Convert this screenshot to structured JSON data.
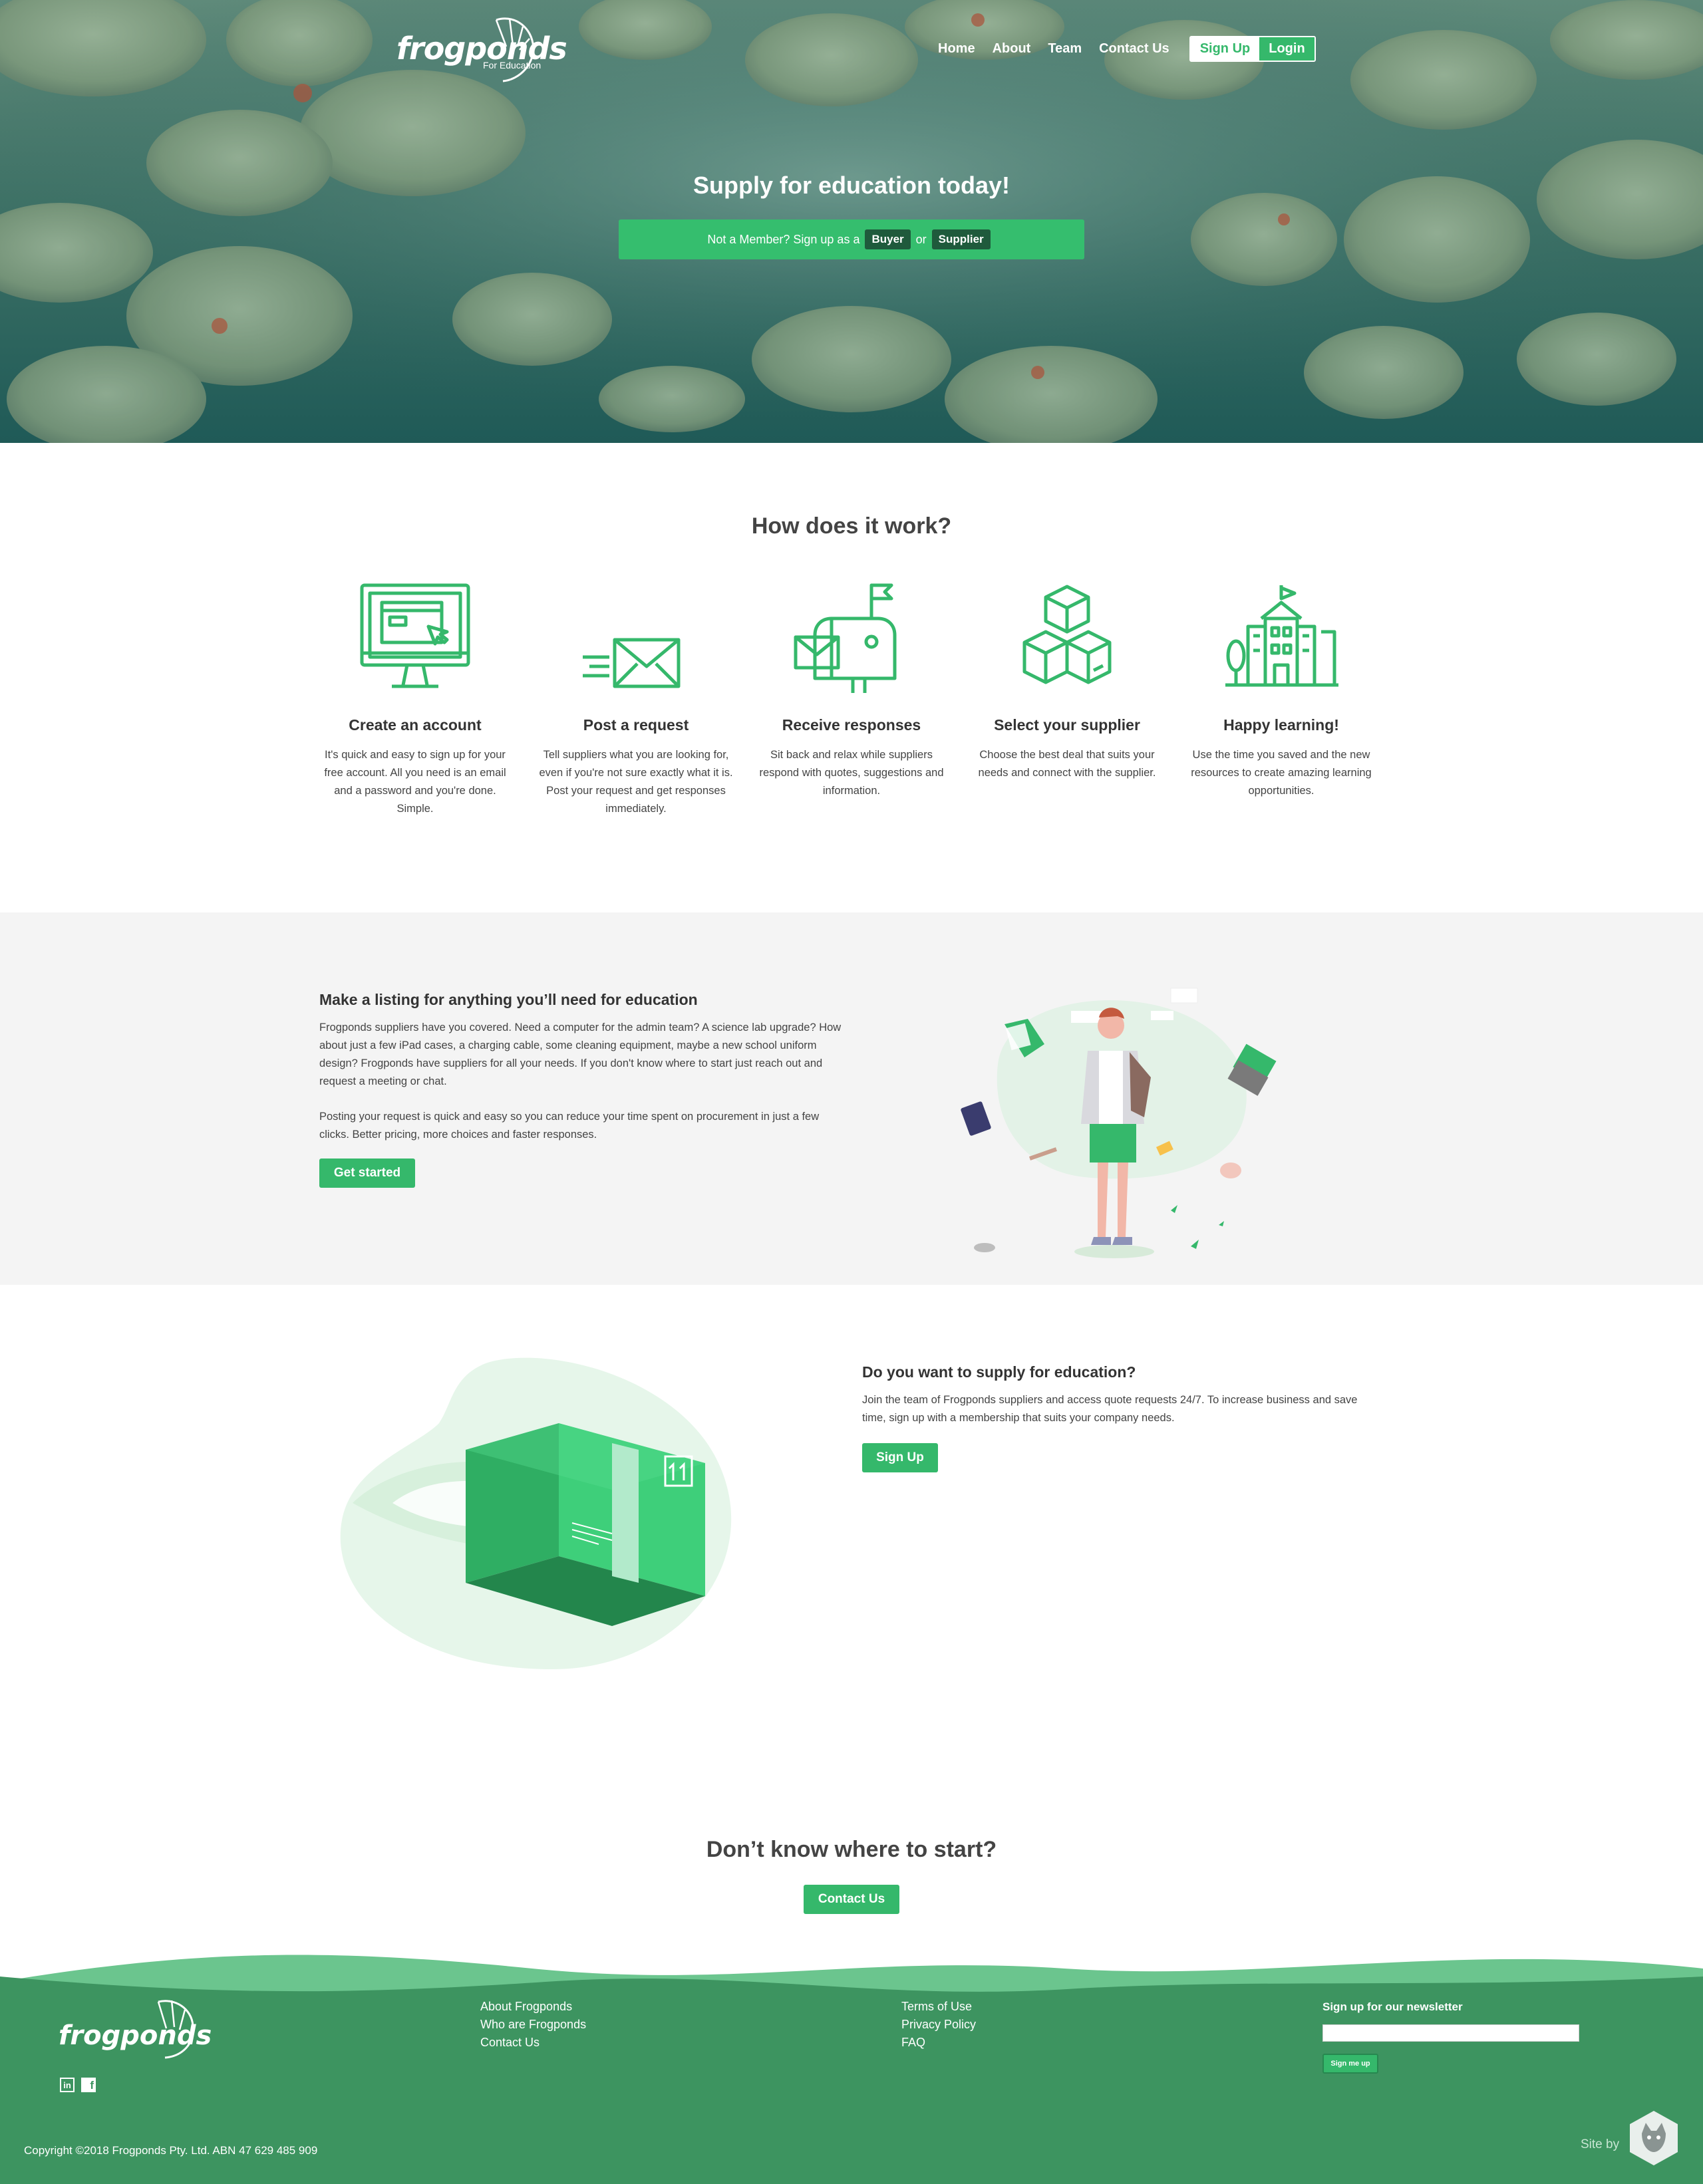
{
  "brand": {
    "name": "frogponds",
    "tagline": "For Education"
  },
  "nav": {
    "home": "Home",
    "about": "About",
    "team": "Team",
    "contact": "Contact Us",
    "signup": "Sign Up",
    "login": "Login"
  },
  "hero": {
    "title": "Supply for education today!",
    "prompt": "Not a Member? Sign up as a",
    "buyer": "Buyer",
    "or": "or",
    "supplier": "Supplier"
  },
  "how": {
    "title": "How does it work?",
    "steps": [
      {
        "title": "Create an account",
        "text": "It's quick and easy to sign up for your free account. All you need is an email and a password and you're done. Simple.",
        "icon": "computer-icon"
      },
      {
        "title": "Post a request",
        "text": "Tell suppliers what you are looking for, even if you're not sure exactly what it is. Post your request and get responses immediately.",
        "icon": "envelope-icon"
      },
      {
        "title": "Receive responses",
        "text": "Sit back and relax while suppliers respond with quotes, suggestions and information.",
        "icon": "mailbox-icon"
      },
      {
        "title": "Select your supplier",
        "text": "Choose the best deal that suits your needs and connect with the supplier.",
        "icon": "boxes-icon"
      },
      {
        "title": "Happy learning!",
        "text": "Use the time you saved and the new resources to create amazing learning opportunities.",
        "icon": "school-icon"
      }
    ]
  },
  "listing": {
    "title": "Make a listing for anything you’ll need for education",
    "p1": "Frogponds suppliers have you covered. Need a computer for the admin team? A science lab upgrade? How about just a few iPad cases, a charging cable, some cleaning equipment, maybe a new school uniform design? Frogponds have suppliers for all your needs. If you don't know where to start just reach out and request a meeting or chat.",
    "p2": "Posting your request is quick and easy so you can reduce your time spent on procurement in just a few clicks. Better pricing, more choices and faster responses.",
    "button": "Get started"
  },
  "supply": {
    "title": "Do you want to supply for education?",
    "text": "Join the team of Frogponds suppliers and access quote requests 24/7. To increase business and save time, sign up with a membership that suits your company needs.",
    "button": "Sign Up"
  },
  "start": {
    "title": "Don’t know where to start?",
    "button": "Contact Us"
  },
  "footer": {
    "col1": [
      "About Frogponds",
      "Who are Frogponds",
      "Contact Us"
    ],
    "col2": [
      "Terms of Use",
      "Privacy Policy",
      "FAQ"
    ],
    "newsletter_title": "Sign up for our newsletter",
    "newsletter_button": "Sign me up",
    "copyright": "Copyright ©2018 Frogponds Pty. Ltd. ABN 47 629 485 909",
    "siteby": "Site by"
  },
  "colors": {
    "accent": "#35b86b",
    "footer": "#3d9460",
    "gray_section": "#f4f4f4"
  }
}
